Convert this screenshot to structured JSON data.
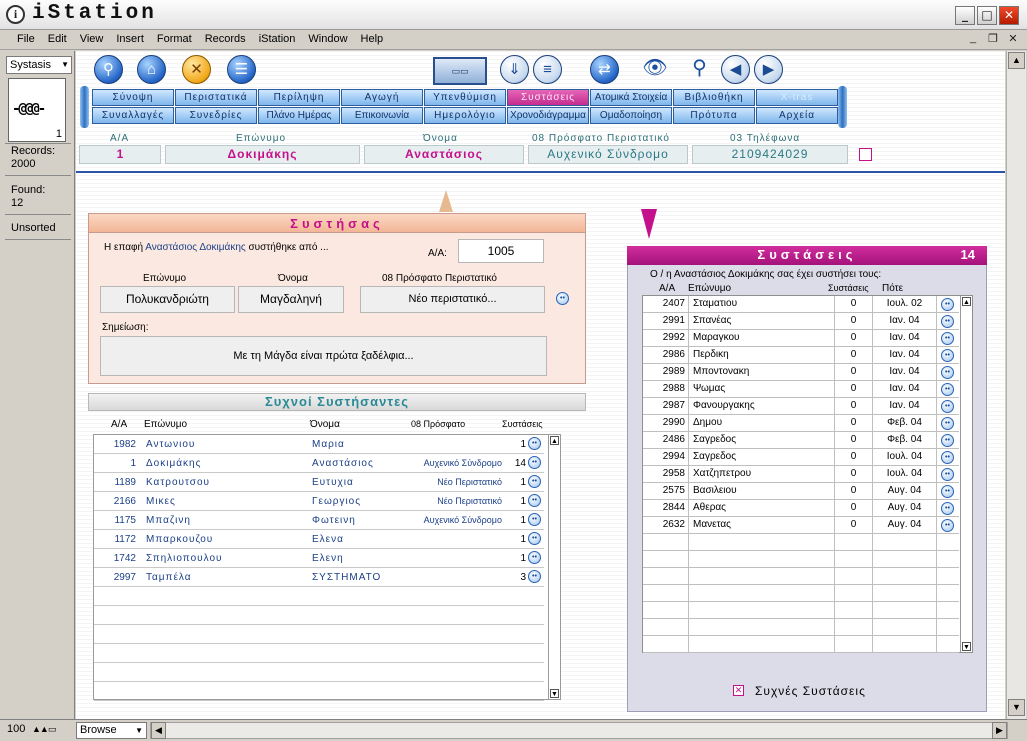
{
  "window": {
    "title": "iStation"
  },
  "menu": [
    "File",
    "Edit",
    "View",
    "Insert",
    "Format",
    "Records",
    "iStation",
    "Window",
    "Help"
  ],
  "left": {
    "layout": "Systasis",
    "page": "1",
    "records_label": "Records:",
    "records": "2000",
    "found_label": "Found:",
    "found": "12",
    "sort": "Unsorted"
  },
  "bottom": {
    "zoom": "100",
    "mode": "Browse"
  },
  "tabs": {
    "row1": [
      "Σύνοψη",
      "Περιστατικά",
      "Περίληψη",
      "Αγωγή",
      "Υπενθύμιση",
      "Συστάσεις",
      "Ατομικά Στοιχεία",
      "Βιβλιοθήκη",
      "X-tras"
    ],
    "row2": [
      "Συναλλαγές",
      "Συνεδρίες",
      "Πλάνο Ημέρας",
      "Επικοινωνία",
      "Ημερολόγιο",
      "Χρονοδιάγραμμα",
      "Ομαδοποίηση",
      "Πρότυπα",
      "Αρχεία"
    ]
  },
  "record": {
    "labels": {
      "aa": "Α/Α",
      "last": "Επώνυμο",
      "first": "Όνομα",
      "recent": "08  Πρόσφατο Περιστατικό",
      "phone": "03  Τηλέφωνα"
    },
    "aa": "1",
    "last": "Δοκιμάκης",
    "first": "Αναστάσιος",
    "recent": "Αυχενικό Σύνδρομο",
    "phone": "2109424029"
  },
  "referrer": {
    "title": "Συστήσας",
    "intro_pre": "Η επαφή ",
    "intro_name": "Αναστάσιος Δοκιμάκης",
    "intro_post": " συστήθηκε από ...",
    "aa_label": "Α/Α:",
    "aa": "1005",
    "labels": {
      "last": "Επώνυμο",
      "first": "Όνομα",
      "recent": "08   Πρόσφατο Περιστατικό",
      "note": "Σημείωση:"
    },
    "last": "Πολυκανδριώτη",
    "first": "Μαγδαληνή",
    "recent": "Νέο περιστατικό...",
    "note": "Με τη Μάγδα είναι πρώτα ξαδέλφια..."
  },
  "frequent": {
    "title": "Συχνοί Συστήσαντες",
    "headers": {
      "aa": "Α/Α",
      "last": "Επώνυμο",
      "first": "Όνομα",
      "recent": "08  Πρόσφατο",
      "count": "Συστάσεις"
    },
    "rows": [
      {
        "aa": "1982",
        "last": "Αντωνιου",
        "first": "Μαρια",
        "recent": "",
        "count": "1"
      },
      {
        "aa": "1",
        "last": "Δοκιμάκης",
        "first": "Αναστάσιος",
        "recent": "Αυχενικό Σύνδρομο",
        "count": "14"
      },
      {
        "aa": "1189",
        "last": "Κατρουτσου",
        "first": "Ευτυχια",
        "recent": "Νέο Περιστατικό",
        "count": "1"
      },
      {
        "aa": "2166",
        "last": "Μικες",
        "first": "Γεωργιος",
        "recent": "Νέο Περιστατικό",
        "count": "1"
      },
      {
        "aa": "1175",
        "last": "Μπαζινη",
        "first": "Φωτεινη",
        "recent": "Αυχενικό Σύνδρομο",
        "count": "1"
      },
      {
        "aa": "1172",
        "last": "Μπαρκουζου",
        "first": "Ελενα",
        "recent": "",
        "count": "1"
      },
      {
        "aa": "1742",
        "last": "Σπηλιοπουλου",
        "first": "Ελενη",
        "recent": "",
        "count": "1"
      },
      {
        "aa": "2997",
        "last": "Ταμπέλα",
        "first": "ΣΥΣΤΗΜΑΤΟ",
        "recent": "",
        "count": "3"
      }
    ]
  },
  "referrals": {
    "title": "Συστάσεις",
    "count": "14",
    "subtitle": "Ο / η Αναστάσιος Δοκιμάκης σας έχει συστήσει τους:",
    "headers": {
      "aa": "Α/Α",
      "last": "Επώνυμο",
      "count": "Συστάσεις",
      "when": "Πότε"
    },
    "rows": [
      {
        "aa": "2407",
        "last": "Σταματιου",
        "count": "0",
        "when": "Ιουλ. 02"
      },
      {
        "aa": "2991",
        "last": "Σπανέας",
        "count": "0",
        "when": "Ιαν. 04"
      },
      {
        "aa": "2992",
        "last": "Μαραγκου",
        "count": "0",
        "when": "Ιαν. 04"
      },
      {
        "aa": "2986",
        "last": "Περδικη",
        "count": "0",
        "when": "Ιαν. 04"
      },
      {
        "aa": "2989",
        "last": "Μποντονακη",
        "count": "0",
        "when": "Ιαν. 04"
      },
      {
        "aa": "2988",
        "last": "Ψωμας",
        "count": "0",
        "when": "Ιαν. 04"
      },
      {
        "aa": "2987",
        "last": "Φανουργακης",
        "count": "0",
        "when": "Ιαν. 04"
      },
      {
        "aa": "2990",
        "last": "Δημου",
        "count": "0",
        "when": "Φεβ. 04"
      },
      {
        "aa": "2486",
        "last": "Σαγρεδος",
        "count": "0",
        "when": "Φεβ. 04"
      },
      {
        "aa": "2994",
        "last": "Σαγρεδος",
        "count": "0",
        "when": "Ιουλ. 04"
      },
      {
        "aa": "2958",
        "last": "Χατζηπετρου",
        "count": "0",
        "when": "Ιουλ. 04"
      },
      {
        "aa": "2575",
        "last": "Βασιλειου",
        "count": "0",
        "when": "Αυγ. 04"
      },
      {
        "aa": "2844",
        "last": "Αθερας",
        "count": "0",
        "when": "Αυγ. 04"
      },
      {
        "aa": "2632",
        "last": "Μανετας",
        "count": "0",
        "when": "Αυγ. 04"
      }
    ],
    "checkbox_label": "Συχνές Συστάσεις"
  },
  "colors": {
    "accent": "#c4108a",
    "tab": "#7fb6ec",
    "teal": "#2a7a85"
  }
}
